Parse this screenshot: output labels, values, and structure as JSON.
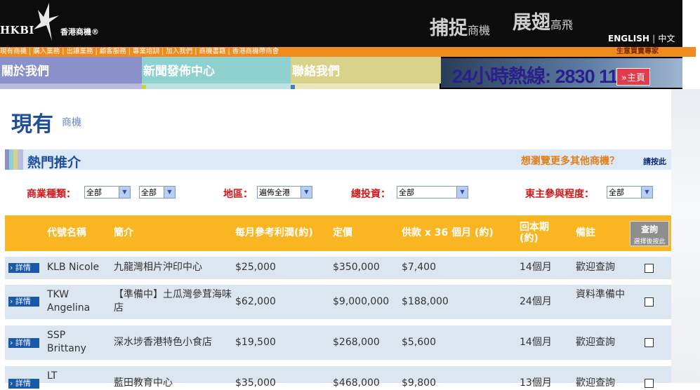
{
  "header": {
    "logo_text": "HKBI",
    "logo_sub": "香港商機®",
    "slogan_1": "捕捉",
    "slogan_1_small": "商機",
    "slogan_2": "展翅",
    "slogan_2_small": "高飛",
    "lang_en": "ENGLISH",
    "lang_sep": "|",
    "lang_zh": "中文"
  },
  "topnav": {
    "links": "現有商機 | 購入業務 | 出讓業務 | 顧客服務 | 專業培訓 | 加入我們 | 商機書籍 | 香港商機帶商會",
    "motto": "生意買賣專家"
  },
  "nav": {
    "tabs": [
      "關於我們",
      "新聞發佈中心",
      "聯絡我們"
    ],
    "hotline_label": "Hour Hotline 小時熱線",
    "hotline_number": "24小時熱線: 2830 1111",
    "home": "»主頁"
  },
  "page": {
    "title": "現有",
    "subtitle": "商機"
  },
  "section": {
    "title": "熱門推介",
    "more": "想瀏覽更多其他商機？",
    "click": "請按此"
  },
  "filters": {
    "category_label": "商業種類：",
    "category_value": "全部",
    "category_sub_value": "全部",
    "region_label": "地區：",
    "region_value": "遍佈全港",
    "investment_label": "總投資：",
    "investment_value": "全部",
    "owner_label": "東主參與程度：",
    "owner_value": "全部"
  },
  "table": {
    "headers": {
      "code": "代號名稱",
      "desc": "簡介",
      "profit": "每月參考利潤(約)",
      "price": "定價",
      "installment": "供款 x 36 個月 (約)",
      "payback": "回本期(約)",
      "remark": "備註",
      "query": "查詢",
      "query_sub": "選擇後按此"
    },
    "detail_label": "詳情",
    "rows": [
      {
        "code": "KLB Nicole",
        "desc": "九龍灣相片沖印中心",
        "profit": "$25,000",
        "price": "$350,000",
        "installment": "$7,400",
        "payback": "14個月",
        "remark": "歡迎查詢"
      },
      {
        "code": "TKW Angelina",
        "desc": "【準備中】土瓜灣參茸海味店",
        "profit": "$62,000",
        "price": "$9,000,000",
        "installment": "$188,000",
        "payback": "24個月",
        "remark": "資料準備中"
      },
      {
        "code": "SSP Brittany",
        "desc": "深水埗香港特色小食店",
        "profit": "$19,500",
        "price": "$268,000",
        "installment": "$5,600",
        "payback": "14個月",
        "remark": "歡迎查詢"
      },
      {
        "code": "LT",
        "desc": "藍田教育中心",
        "profit": "$35,000",
        "price": "$468,000",
        "installment": "$9,800",
        "payback": "13個月",
        "remark": "歡迎查詢"
      }
    ]
  },
  "colors": {
    "accent_orange": "#f08a1c",
    "header_yellow": "#f9b622",
    "title_blue": "#1f4e9c",
    "filter_red": "#d2171b"
  }
}
